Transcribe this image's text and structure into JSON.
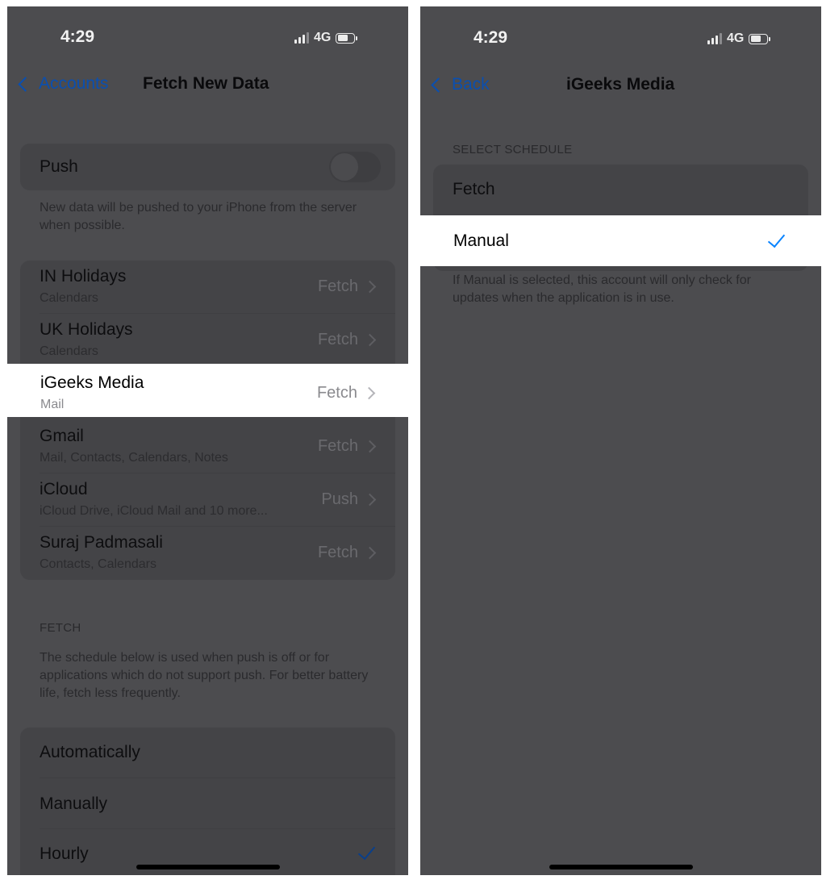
{
  "left": {
    "status": {
      "time": "4:29",
      "network": "4G"
    },
    "nav": {
      "back_label": "Accounts",
      "title": "Fetch New Data"
    },
    "push": {
      "label": "Push",
      "footnote": "New data will be pushed to your iPhone from the server when possible."
    },
    "accounts": [
      {
        "name": "IN Holidays",
        "sub": "Calendars",
        "value": "Fetch"
      },
      {
        "name": "UK Holidays",
        "sub": "Calendars",
        "value": "Fetch"
      },
      {
        "name": "iGeeks Media",
        "sub": "Mail",
        "value": "Fetch"
      },
      {
        "name": "Gmail",
        "sub": "Mail, Contacts, Calendars, Notes",
        "value": "Fetch"
      },
      {
        "name": "iCloud",
        "sub": "iCloud Drive, iCloud Mail and 10 more...",
        "value": "Push"
      },
      {
        "name": "Suraj Padmasali",
        "sub": "Contacts, Calendars",
        "value": "Fetch"
      }
    ],
    "fetch": {
      "header": "FETCH",
      "footnote": "The schedule below is used when push is off or for applications which do not support push. For better battery life, fetch less frequently.",
      "options": [
        "Automatically",
        "Manually",
        "Hourly"
      ],
      "selected": "Hourly"
    }
  },
  "right": {
    "status": {
      "time": "4:29",
      "network": "4G"
    },
    "nav": {
      "back_label": "Back",
      "title": "iGeeks Media"
    },
    "schedule": {
      "header": "SELECT SCHEDULE",
      "options": [
        "Fetch",
        "Manual"
      ],
      "selected": "Manual",
      "footnote": "If Manual is selected, this account will only check for updates when the application is in use."
    }
  },
  "colors": {
    "accent": "#0a84ff",
    "dim_overlay": "#4c4c4f",
    "highlight": "#ffffff"
  }
}
